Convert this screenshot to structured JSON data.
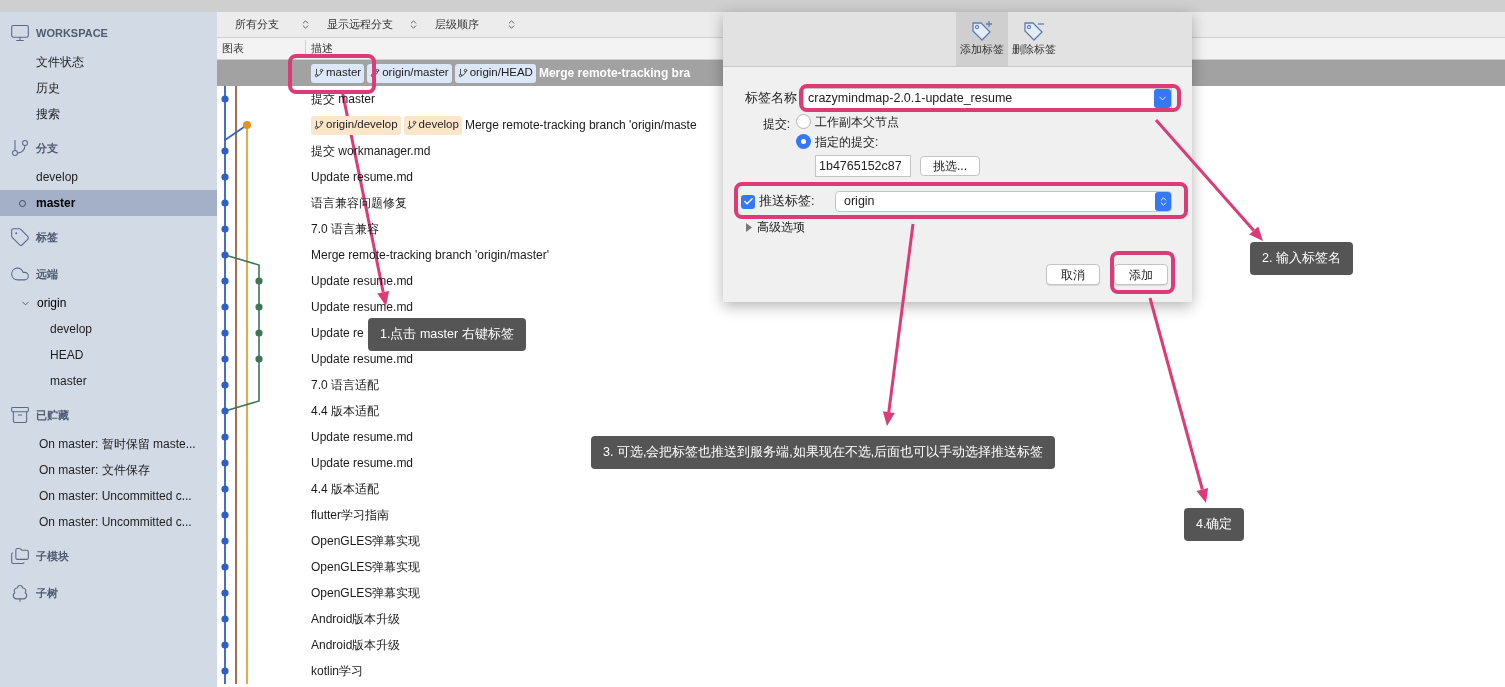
{
  "sidebar": {
    "sections": [
      {
        "kind": "workspace",
        "title": "WORKSPACE",
        "items": [
          {
            "label": "文件状态",
            "selected": false
          },
          {
            "label": "历史",
            "selected": false
          },
          {
            "label": "搜索",
            "selected": false
          }
        ]
      },
      {
        "kind": "branches",
        "title": "分支",
        "items": [
          {
            "label": "develop",
            "selected": false,
            "current": false
          },
          {
            "label": "master",
            "selected": true,
            "current": true
          }
        ]
      },
      {
        "kind": "tags",
        "title": "标签"
      },
      {
        "kind": "remotes",
        "title": "远端",
        "items": [
          {
            "label": "origin",
            "selected": false,
            "expanded": true,
            "children": [
              {
                "label": "develop",
                "selected": false
              },
              {
                "label": "HEAD",
                "selected": false
              },
              {
                "label": "master",
                "selected": false
              }
            ]
          }
        ]
      },
      {
        "kind": "stashes",
        "title": "已贮藏",
        "items": [
          {
            "label": "On master: 暂时保留 maste...",
            "selected": false
          },
          {
            "label": "On master: 文件保存",
            "selected": false
          },
          {
            "label": "On master: Uncommitted c...",
            "selected": false
          },
          {
            "label": "On master: Uncommitted c...",
            "selected": false
          }
        ]
      },
      {
        "kind": "submodules",
        "title": "子模块"
      },
      {
        "kind": "subtrees",
        "title": "子树"
      }
    ]
  },
  "toolbar": {
    "dropdowns": [
      "所有分支",
      "显示远程分支",
      "层级顺序"
    ]
  },
  "table": {
    "columns": [
      "图表",
      "描述"
    ],
    "rows": [
      {
        "selected": true,
        "refs": [
          {
            "label": "master",
            "color": "#dce7f7"
          },
          {
            "label": "origin/master",
            "color": "#dce7f7"
          },
          {
            "label": "origin/HEAD",
            "color": "#dce7f7"
          }
        ],
        "description": "Merge remote-tracking bra"
      },
      {
        "selected": false,
        "description": "提交 master"
      },
      {
        "selected": false,
        "refs": [
          {
            "label": "origin/develop",
            "color": "#fbe6cc"
          },
          {
            "label": "develop",
            "color": "#fbe6cc"
          }
        ],
        "description": "Merge remote-tracking branch 'origin/maste"
      },
      {
        "selected": false,
        "description": "提交 workmanager.md"
      },
      {
        "selected": false,
        "description": "Update resume.md"
      },
      {
        "selected": false,
        "description": "语言兼容问题修复"
      },
      {
        "selected": false,
        "description": "7.0 语言兼容"
      },
      {
        "selected": false,
        "description": "Merge remote-tracking branch 'origin/master'"
      },
      {
        "selected": false,
        "description": "Update resume.md"
      },
      {
        "selected": false,
        "description": "Update resume.md"
      },
      {
        "selected": false,
        "description": "Update re"
      },
      {
        "selected": false,
        "description": "Update resume.md"
      },
      {
        "selected": false,
        "description": "7.0 语言适配"
      },
      {
        "selected": false,
        "description": "4.4 版本适配"
      },
      {
        "selected": false,
        "description": "Update resume.md"
      },
      {
        "selected": false,
        "description": "Update resume.md"
      },
      {
        "selected": false,
        "description": "4.4 版本适配"
      },
      {
        "selected": false,
        "description": "flutter学习指南"
      },
      {
        "selected": false,
        "description": "OpenGLES弹幕实现"
      },
      {
        "selected": false,
        "description": "OpenGLES弹幕实现"
      },
      {
        "selected": false,
        "description": "OpenGLES弹幕实现"
      },
      {
        "selected": false,
        "description": "Android版本升级"
      },
      {
        "selected": false,
        "description": "Android版本升级"
      },
      {
        "selected": false,
        "description": "kotlin学习"
      }
    ]
  },
  "dialog": {
    "tabs": [
      {
        "kind": "add",
        "label": "添加标签",
        "selected": true
      },
      {
        "kind": "remove",
        "label": "删除标签",
        "selected": false
      }
    ],
    "tag_name": {
      "label": "标签名称",
      "value": "crazymindmap-2.0.1-update_resume"
    },
    "commit": {
      "label": "提交:",
      "options": [
        {
          "label": "工作副本父节点",
          "selected": false
        },
        {
          "label": "指定的提交:",
          "selected": true
        }
      ],
      "hash": "1b4765152c87",
      "pick_button": "挑选..."
    },
    "push": {
      "label": "推送标签:",
      "checked": true,
      "remote": "origin"
    },
    "advanced": {
      "label": "高级选项",
      "expanded": false
    },
    "buttons": [
      "取消",
      "添加"
    ]
  },
  "annotations": [
    "1.点击 master 右键标签",
    "2. 输入标签名",
    "3. 可选,会把标签也推送到服务端,如果现在不选,后面也可以手动选择推送标签",
    "4.确定"
  ]
}
